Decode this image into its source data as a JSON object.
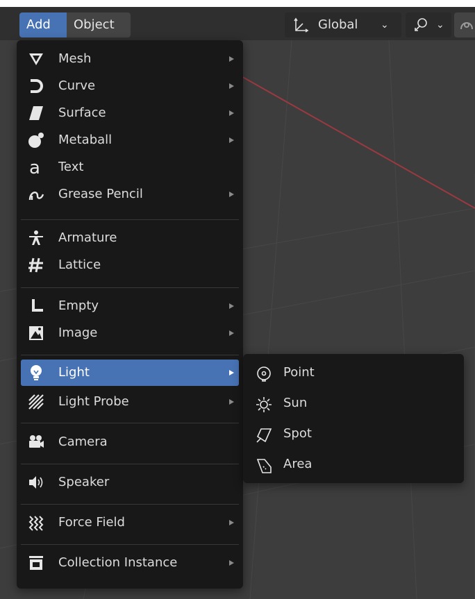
{
  "header": {
    "menus": [
      {
        "label": "Add",
        "active": true
      },
      {
        "label": "Object",
        "active": false
      }
    ],
    "orientation": {
      "icon": "transform-orientation-icon",
      "label": "Global"
    },
    "snapping": {
      "icon": "snap-icon"
    },
    "proportional_editing": {
      "icon": "proportional-edit-icon"
    }
  },
  "add_menu": {
    "items": [
      {
        "label": "Mesh",
        "icon": "mesh-icon",
        "submenu": true
      },
      {
        "label": "Curve",
        "icon": "curve-icon",
        "submenu": true
      },
      {
        "label": "Surface",
        "icon": "surface-icon",
        "submenu": true
      },
      {
        "label": "Metaball",
        "icon": "metaball-icon",
        "submenu": true
      },
      {
        "label": "Text",
        "icon": "text-icon",
        "submenu": false
      },
      {
        "label": "Grease Pencil",
        "icon": "grease-pencil-icon",
        "submenu": true
      },
      {
        "label": "Armature",
        "icon": "armature-icon",
        "submenu": false
      },
      {
        "label": "Lattice",
        "icon": "lattice-icon",
        "submenu": false
      },
      {
        "label": "Empty",
        "icon": "empty-icon",
        "submenu": true
      },
      {
        "label": "Image",
        "icon": "image-icon",
        "submenu": true
      },
      {
        "label": "Light",
        "icon": "light-bulb-icon",
        "submenu": true,
        "active": true
      },
      {
        "label": "Light Probe",
        "icon": "light-probe-icon",
        "submenu": true
      },
      {
        "label": "Camera",
        "icon": "camera-icon",
        "submenu": false
      },
      {
        "label": "Speaker",
        "icon": "speaker-icon",
        "submenu": false
      },
      {
        "label": "Force Field",
        "icon": "force-field-icon",
        "submenu": true
      },
      {
        "label": "Collection Instance",
        "icon": "collection-instance-icon",
        "submenu": true
      }
    ]
  },
  "light_submenu": {
    "items": [
      {
        "label": "Point",
        "icon": "point-light-icon"
      },
      {
        "label": "Sun",
        "icon": "sun-light-icon"
      },
      {
        "label": "Spot",
        "icon": "spot-light-icon"
      },
      {
        "label": "Area",
        "icon": "area-light-icon"
      }
    ]
  },
  "colors": {
    "accent": "#4772b3",
    "menu_bg": "#181818",
    "viewport_bg": "#3d3d3d",
    "x_axis": "#b2454c"
  }
}
